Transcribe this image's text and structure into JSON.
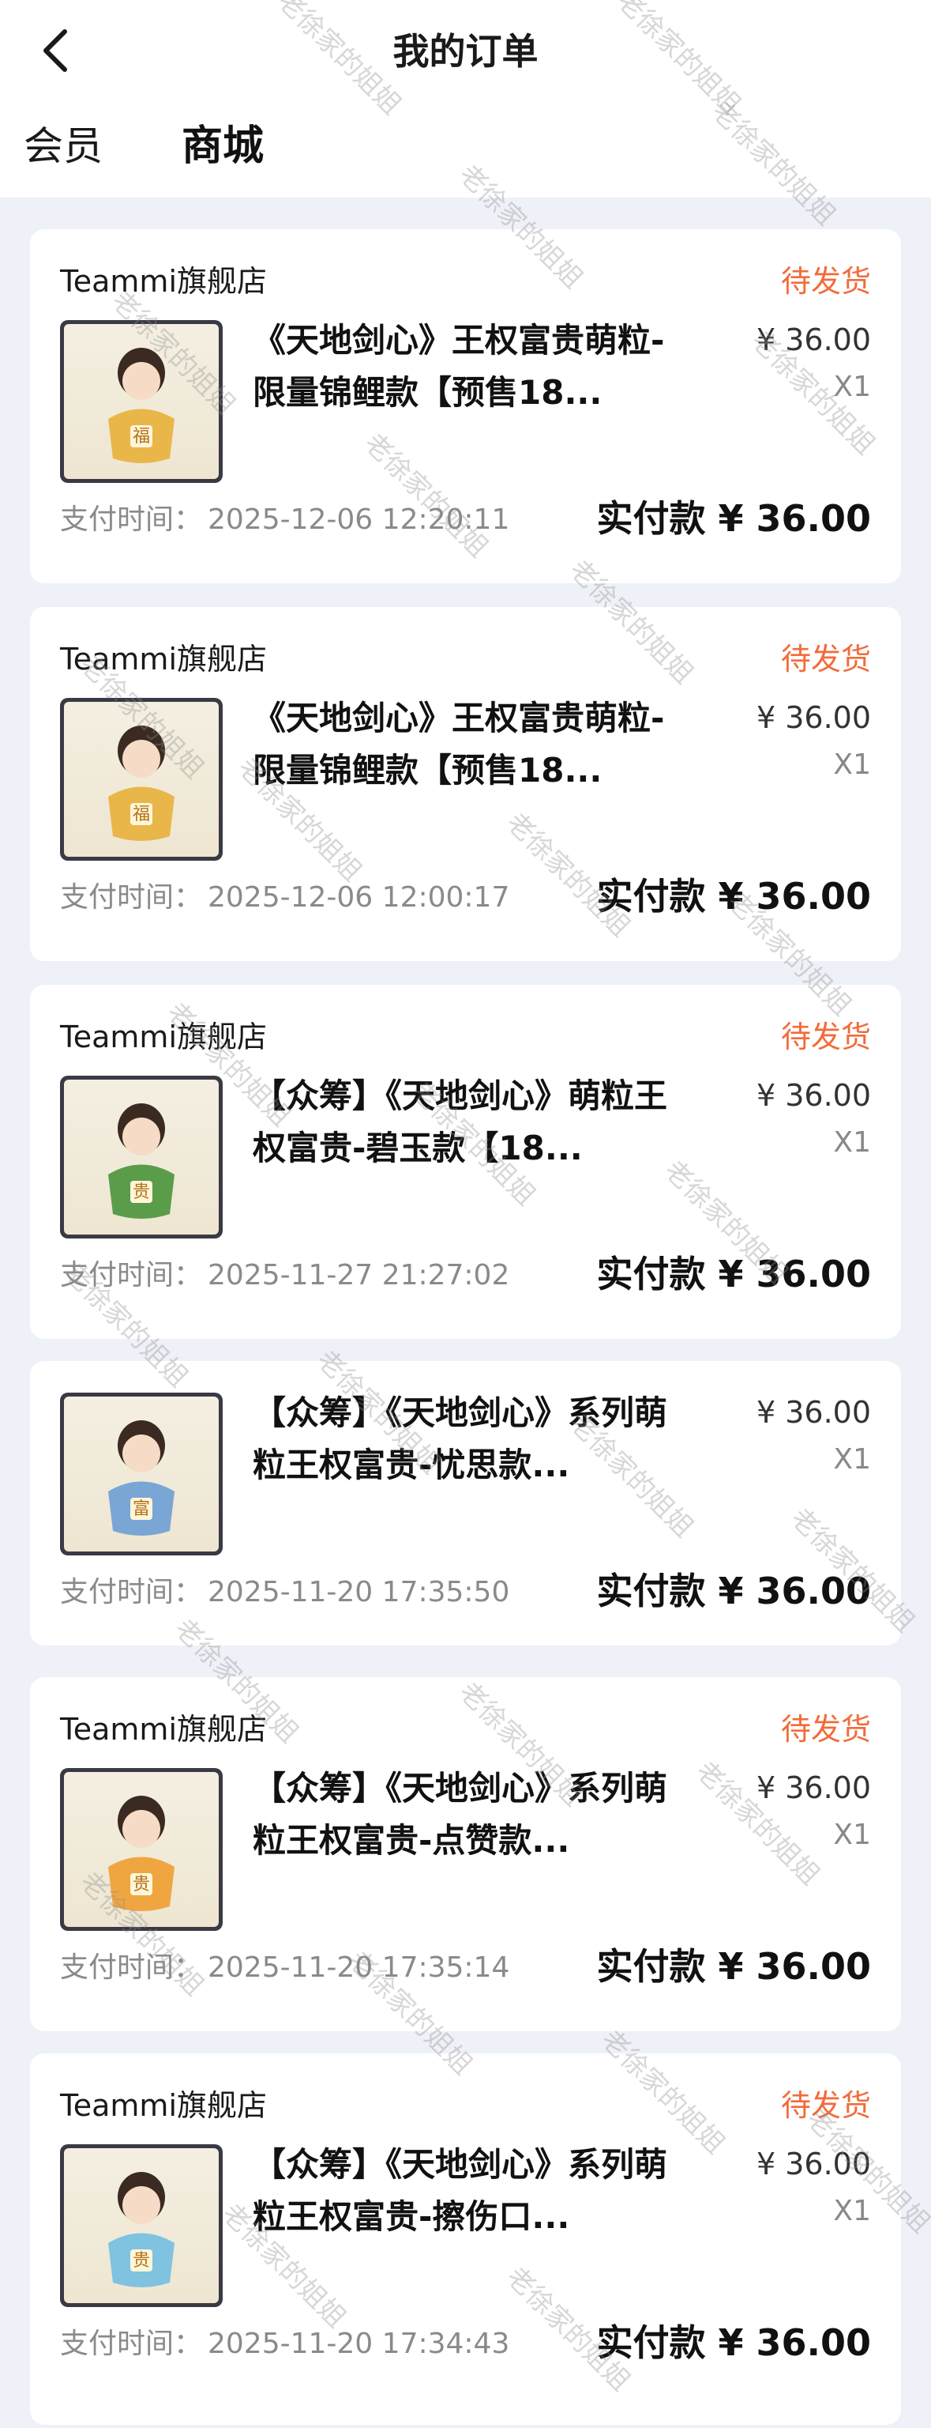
{
  "header": {
    "title": "我的订单",
    "tabs": [
      {
        "label": "会员",
        "active": false
      },
      {
        "label": "商城",
        "active": true
      }
    ]
  },
  "colors": {
    "status": "#f26b3a",
    "background": "#eef1f7",
    "card": "#ffffff"
  },
  "watermark": "老徐家的姐姐",
  "orders": [
    {
      "store": "Teammi旗舰店",
      "status": "待发货",
      "product": "《天地剑心》王权富贵萌粒-限量锦鲤款【预售18...",
      "unit_price": "¥ 36.00",
      "qty": "X1",
      "pay_time_label": "支付时间：",
      "pay_time": "2025-12-06 12:20:11",
      "paid_amount": "实付款 ¥ 36.00",
      "thumb_color": "#e9b64a",
      "thumb_char": "福"
    },
    {
      "store": "Teammi旗舰店",
      "status": "待发货",
      "product": "《天地剑心》王权富贵萌粒-限量锦鲤款【预售18...",
      "unit_price": "¥ 36.00",
      "qty": "X1",
      "pay_time_label": "支付时间：",
      "pay_time": "2025-12-06 12:00:17",
      "paid_amount": "实付款 ¥ 36.00",
      "thumb_color": "#e9b64a",
      "thumb_char": "福"
    },
    {
      "store": "Teammi旗舰店",
      "status": "待发货",
      "product": "【众筹】《天地剑心》萌粒王权富贵-碧玉款【18...",
      "unit_price": "¥ 36.00",
      "qty": "X1",
      "pay_time_label": "支付时间：",
      "pay_time": "2025-11-27 21:27:02",
      "paid_amount": "实付款 ¥ 36.00",
      "thumb_color": "#5a9c4a",
      "thumb_char": "贵"
    },
    {
      "store": "",
      "status": "",
      "product": "【众筹】《天地剑心》系列萌粒王权富贵-忧思款...",
      "unit_price": "¥ 36.00",
      "qty": "X1",
      "pay_time_label": "支付时间：",
      "pay_time": "2025-11-20 17:35:50",
      "paid_amount": "实付款 ¥ 36.00",
      "thumb_color": "#7aa6d6",
      "thumb_char": "富"
    },
    {
      "store": "Teammi旗舰店",
      "status": "待发货",
      "product": "【众筹】《天地剑心》系列萌粒王权富贵-点赞款...",
      "unit_price": "¥ 36.00",
      "qty": "X1",
      "pay_time_label": "支付时间：",
      "pay_time": "2025-11-20 17:35:14",
      "paid_amount": "实付款 ¥ 36.00",
      "thumb_color": "#f0a640",
      "thumb_char": "贵"
    },
    {
      "store": "Teammi旗舰店",
      "status": "待发货",
      "product": "【众筹】《天地剑心》系列萌粒王权富贵-擦伤口...",
      "unit_price": "¥ 36.00",
      "qty": "X1",
      "pay_time_label": "支付时间：",
      "pay_time": "2025-11-20 17:34:43",
      "paid_amount": "实付款 ¥ 36.00",
      "thumb_color": "#7fc3e0",
      "thumb_char": "贵"
    }
  ]
}
